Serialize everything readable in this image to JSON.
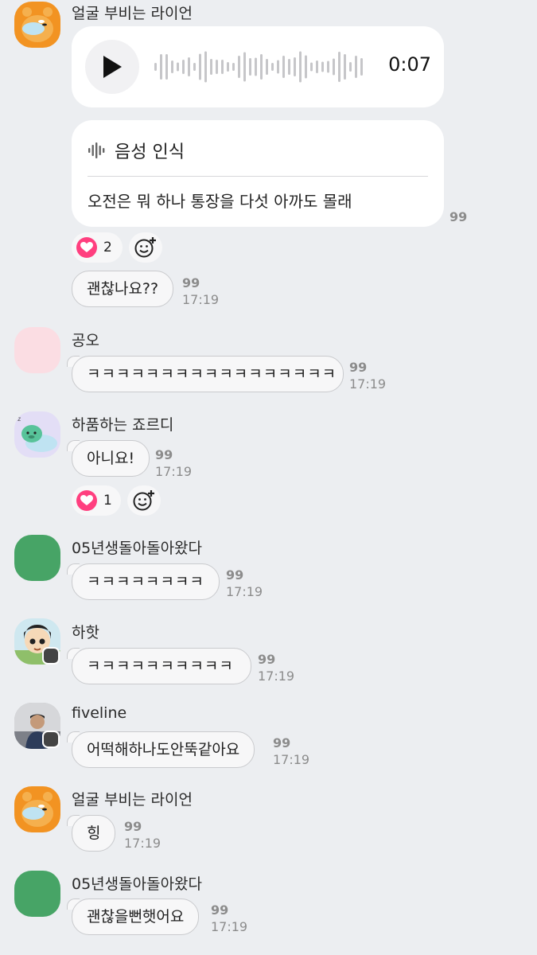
{
  "messages": {
    "m1": {
      "sender": "얼굴 부비는 라이언",
      "voice_duration": "0:07",
      "stt_label": "음성 인식",
      "stt_text": "오전은 뭐 하나 통장을 다섯 아까도 몰래",
      "unread": "99",
      "reaction_count": "2"
    },
    "m2": {
      "text": "괜찮나요??",
      "unread": "99",
      "time": "17:19"
    },
    "m3": {
      "sender": "공오",
      "text": "ㅋㅋㅋㅋㅋㅋㅋㅋㅋㅋㅋㅋㅋㅋㅋㅋㅋ",
      "unread": "99",
      "time": "17:19"
    },
    "m4": {
      "sender": "하품하는 죠르디",
      "text": "아니요!",
      "unread": "99",
      "time": "17:19",
      "reaction_count": "1"
    },
    "m5": {
      "sender": "05년생돌아돌아왔다",
      "text": "ㅋㅋㅋㅋㅋㅋㅋㅋ",
      "unread": "99",
      "time": "17:19"
    },
    "m6": {
      "sender": "하핫",
      "text": "ㅋㅋㅋㅋㅋㅋㅋㅋㅋㅋ",
      "unread": "99",
      "time": "17:19"
    },
    "m7": {
      "sender": "fiveline",
      "text": "어떡해하나도안뚝같아요",
      "unread": "99",
      "time": "17:19"
    },
    "m8": {
      "sender": "얼굴 부비는 라이언",
      "text": "힝",
      "unread": "99",
      "time": "17:19"
    },
    "m9": {
      "sender": "05년생돌아돌아왔다",
      "text": "괜찮을뻔햇어요",
      "unread": "99",
      "time": "17:19"
    }
  },
  "colors": {
    "background": "#eceef1",
    "heart": "#ff3f7f",
    "avatar_pink": "#fbdde3",
    "avatar_green": "#47a466",
    "avatar_orange": "#f29322"
  },
  "icons": [
    "play-icon",
    "waveform-icon",
    "heart-icon",
    "add-emoji-icon"
  ]
}
